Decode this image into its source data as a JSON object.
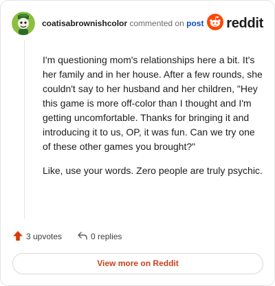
{
  "header": {
    "username": "coatisabrownishcolor",
    "action_text": "commented on",
    "post_link": "post",
    "brand": "reddit"
  },
  "comment": {
    "paragraphs": [
      "I'm questioning mom's relationships here a bit. It's her family and in her house. After a few rounds, she couldn't say to her husband and her children, \"Hey this game is more off-color than I thought and I'm getting uncomfortable. Thanks for bringing it and introducing it to us, OP, it was fun. Can we try one of these other games you brought?\"",
      "Like, use your words. Zero people are truly psychic."
    ]
  },
  "footer": {
    "upvotes": "3 upvotes",
    "replies": "0 replies",
    "view_more": "View more on Reddit"
  },
  "colors": {
    "reddit_orange": "#ff4500",
    "upvote_orange": "#d93a00",
    "link_blue": "#0a4fc2",
    "view_more_text": "#c8411d",
    "avatar_bg": "#8bbf3f"
  },
  "icons": {
    "avatar": "avatar-icon",
    "brand": "reddit-logo-icon",
    "upvote": "upvote-arrow-icon",
    "reply": "reply-arrow-icon"
  }
}
